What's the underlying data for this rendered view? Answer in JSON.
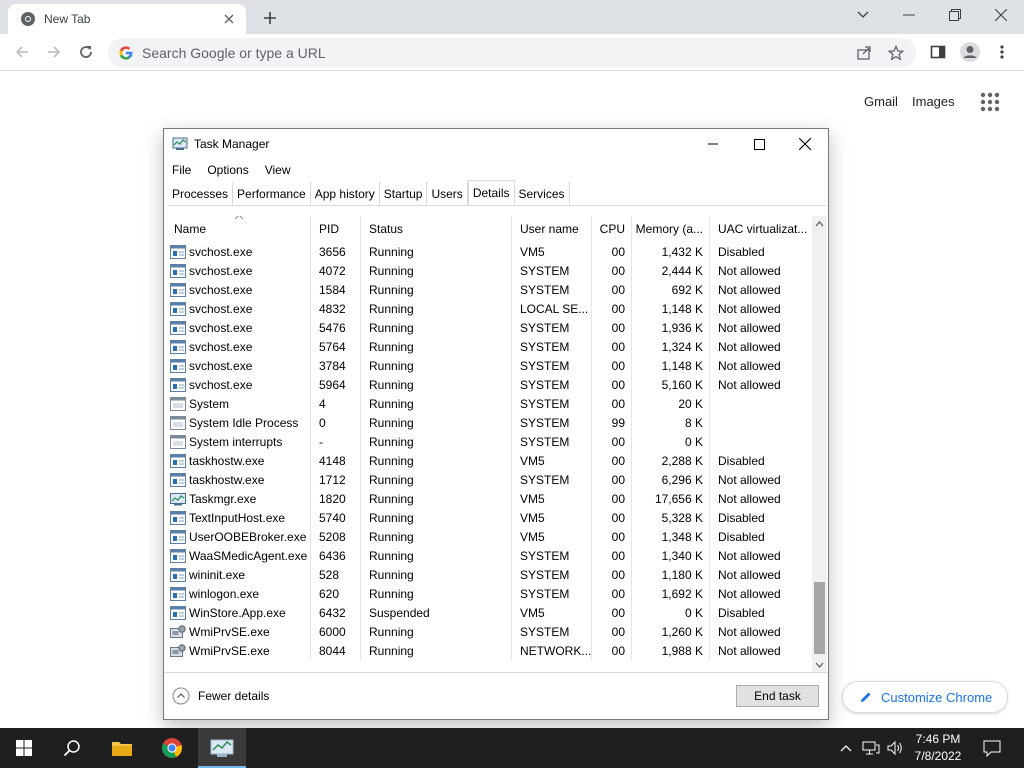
{
  "browser": {
    "tab_title": "New Tab",
    "omnibox_placeholder": "Search Google or type a URL",
    "ntp_links": [
      "Gmail",
      "Images"
    ],
    "customize_label": "Customize Chrome",
    "accent": "#1a73e8"
  },
  "task_manager": {
    "title": "Task Manager",
    "menu": [
      "File",
      "Options",
      "View"
    ],
    "tabs": [
      "Processes",
      "Performance",
      "App history",
      "Startup",
      "Users",
      "Details",
      "Services"
    ],
    "active_tab": "Details",
    "columns": {
      "name": "Name",
      "pid": "PID",
      "status": "Status",
      "user": "User name",
      "cpu": "CPU",
      "memory": "Memory (a...",
      "uac": "UAC virtualizat..."
    },
    "rows": [
      {
        "name": "svchost.exe",
        "pid": "3656",
        "status": "Running",
        "user": "VM5",
        "cpu": "00",
        "memory": "1,432 K",
        "uac": "Disabled",
        "icon": "service-icon"
      },
      {
        "name": "svchost.exe",
        "pid": "4072",
        "status": "Running",
        "user": "SYSTEM",
        "cpu": "00",
        "memory": "2,444 K",
        "uac": "Not allowed",
        "icon": "service-icon"
      },
      {
        "name": "svchost.exe",
        "pid": "1584",
        "status": "Running",
        "user": "SYSTEM",
        "cpu": "00",
        "memory": "692 K",
        "uac": "Not allowed",
        "icon": "service-icon"
      },
      {
        "name": "svchost.exe",
        "pid": "4832",
        "status": "Running",
        "user": "LOCAL SE...",
        "cpu": "00",
        "memory": "1,148 K",
        "uac": "Not allowed",
        "icon": "service-icon"
      },
      {
        "name": "svchost.exe",
        "pid": "5476",
        "status": "Running",
        "user": "SYSTEM",
        "cpu": "00",
        "memory": "1,936 K",
        "uac": "Not allowed",
        "icon": "service-icon"
      },
      {
        "name": "svchost.exe",
        "pid": "5764",
        "status": "Running",
        "user": "SYSTEM",
        "cpu": "00",
        "memory": "1,324 K",
        "uac": "Not allowed",
        "icon": "service-icon"
      },
      {
        "name": "svchost.exe",
        "pid": "3784",
        "status": "Running",
        "user": "SYSTEM",
        "cpu": "00",
        "memory": "1,148 K",
        "uac": "Not allowed",
        "icon": "service-icon"
      },
      {
        "name": "svchost.exe",
        "pid": "5964",
        "status": "Running",
        "user": "SYSTEM",
        "cpu": "00",
        "memory": "5,160 K",
        "uac": "Not allowed",
        "icon": "service-icon"
      },
      {
        "name": "System",
        "pid": "4",
        "status": "Running",
        "user": "SYSTEM",
        "cpu": "00",
        "memory": "20 K",
        "uac": "",
        "icon": "system-icon"
      },
      {
        "name": "System Idle Process",
        "pid": "0",
        "status": "Running",
        "user": "SYSTEM",
        "cpu": "99",
        "memory": "8 K",
        "uac": "",
        "icon": "system-icon"
      },
      {
        "name": "System interrupts",
        "pid": "-",
        "status": "Running",
        "user": "SYSTEM",
        "cpu": "00",
        "memory": "0 K",
        "uac": "",
        "icon": "system-icon"
      },
      {
        "name": "taskhostw.exe",
        "pid": "4148",
        "status": "Running",
        "user": "VM5",
        "cpu": "00",
        "memory": "2,288 K",
        "uac": "Disabled",
        "icon": "service-icon"
      },
      {
        "name": "taskhostw.exe",
        "pid": "1712",
        "status": "Running",
        "user": "SYSTEM",
        "cpu": "00",
        "memory": "6,296 K",
        "uac": "Not allowed",
        "icon": "service-icon"
      },
      {
        "name": "Taskmgr.exe",
        "pid": "1820",
        "status": "Running",
        "user": "VM5",
        "cpu": "00",
        "memory": "17,656 K",
        "uac": "Not allowed",
        "icon": "taskmgr-icon"
      },
      {
        "name": "TextInputHost.exe",
        "pid": "5740",
        "status": "Running",
        "user": "VM5",
        "cpu": "00",
        "memory": "5,328 K",
        "uac": "Disabled",
        "icon": "service-icon"
      },
      {
        "name": "UserOOBEBroker.exe",
        "pid": "5208",
        "status": "Running",
        "user": "VM5",
        "cpu": "00",
        "memory": "1,348 K",
        "uac": "Disabled",
        "icon": "service-icon"
      },
      {
        "name": "WaaSMedicAgent.exe",
        "pid": "6436",
        "status": "Running",
        "user": "SYSTEM",
        "cpu": "00",
        "memory": "1,340 K",
        "uac": "Not allowed",
        "icon": "service-icon"
      },
      {
        "name": "wininit.exe",
        "pid": "528",
        "status": "Running",
        "user": "SYSTEM",
        "cpu": "00",
        "memory": "1,180 K",
        "uac": "Not allowed",
        "icon": "service-icon"
      },
      {
        "name": "winlogon.exe",
        "pid": "620",
        "status": "Running",
        "user": "SYSTEM",
        "cpu": "00",
        "memory": "1,692 K",
        "uac": "Not allowed",
        "icon": "service-icon"
      },
      {
        "name": "WinStore.App.exe",
        "pid": "6432",
        "status": "Suspended",
        "user": "VM5",
        "cpu": "00",
        "memory": "0 K",
        "uac": "Disabled",
        "icon": "service-icon"
      },
      {
        "name": "WmiPrvSE.exe",
        "pid": "6000",
        "status": "Running",
        "user": "SYSTEM",
        "cpu": "00",
        "memory": "1,260 K",
        "uac": "Not allowed",
        "icon": "wmi-icon"
      },
      {
        "name": "WmiPrvSE.exe",
        "pid": "8044",
        "status": "Running",
        "user": "NETWORK...",
        "cpu": "00",
        "memory": "1,988 K",
        "uac": "Not allowed",
        "icon": "wmi-icon"
      }
    ],
    "fewer_details": "Fewer details",
    "end_task": "End task"
  },
  "taskbar": {
    "clock_time": "7:46 PM",
    "clock_date": "7/8/2022",
    "accent": "#76b9ed"
  }
}
